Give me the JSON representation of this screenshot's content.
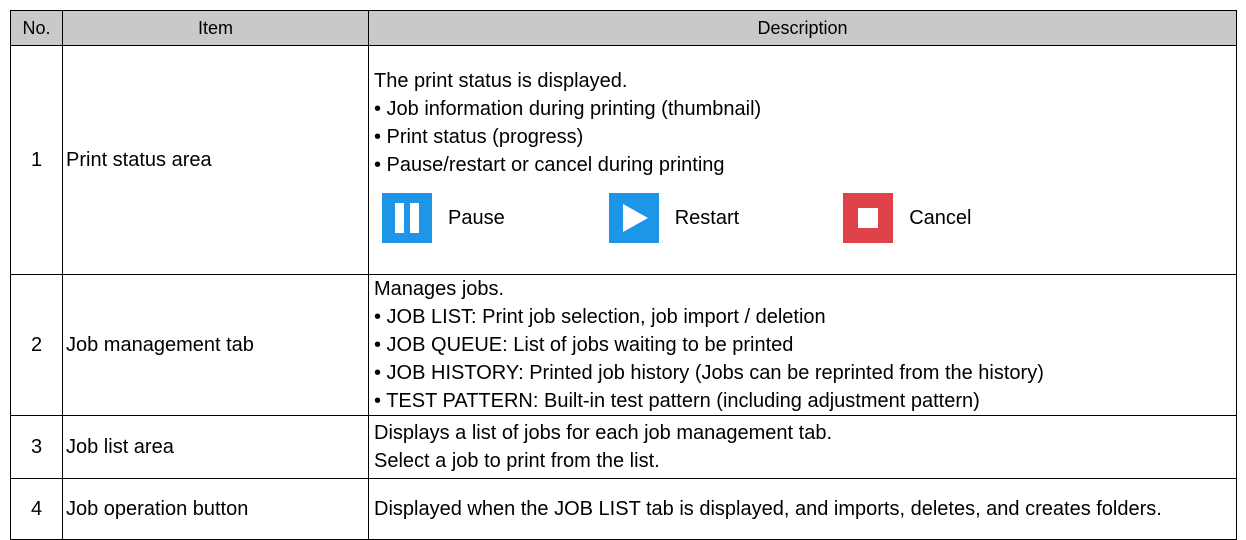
{
  "table": {
    "headers": {
      "no": "No.",
      "item": "Item",
      "description": "Description"
    },
    "rows": [
      {
        "no": "1",
        "item": "Print status area",
        "lines": [
          "The print status is displayed.",
          "• Job information during printing (thumbnail)",
          "• Print status (progress)",
          "• Pause/restart or cancel during printing"
        ],
        "buttons": [
          {
            "label": "Pause",
            "icon": "pause-icon",
            "color": "#1e96e8"
          },
          {
            "label": "Restart",
            "icon": "play-icon",
            "color": "#1e96e8"
          },
          {
            "label": "Cancel",
            "icon": "stop-icon",
            "color": "#e0424a"
          }
        ]
      },
      {
        "no": "2",
        "item": "Job management tab",
        "lines": [
          "Manages jobs.",
          "• JOB LIST: Print job selection, job import / deletion",
          "• JOB QUEUE: List of jobs waiting to be printed",
          "• JOB HISTORY: Printed job history (Jobs can be reprinted from the history)",
          "• TEST PATTERN: Built-in test pattern (including adjustment pattern)"
        ]
      },
      {
        "no": "3",
        "item": "Job list area",
        "lines": [
          "Displays a list of jobs for each job management tab.",
          "Select a job to print from the list."
        ]
      },
      {
        "no": "4",
        "item": "Job operation button",
        "lines": [
          "Displayed when the JOB LIST tab is displayed, and imports, deletes, and creates folders."
        ]
      }
    ]
  },
  "colors": {
    "header_bg": "#c9c9c9",
    "border": "#000000",
    "accent_blue": "#1e96e8",
    "accent_red": "#e0424a"
  }
}
